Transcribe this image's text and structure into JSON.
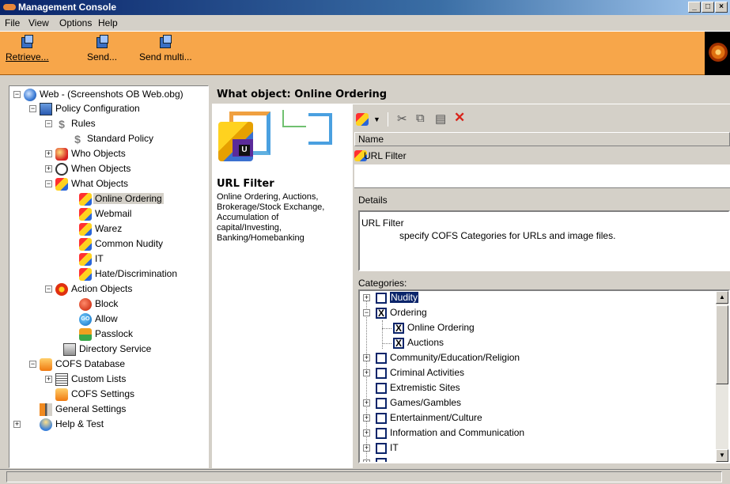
{
  "window": {
    "title": "Management Console",
    "controls": {
      "minimize": "_",
      "maximize": "□",
      "close": "×"
    }
  },
  "menu": {
    "items": [
      "File",
      "View",
      "Options",
      "Help"
    ]
  },
  "toolbar": {
    "buttons": [
      "Retrieve...",
      "Send...",
      "Send multi..."
    ]
  },
  "tree": {
    "root": "Web - (Screenshots OB Web.obg)",
    "policy_config": "Policy Configuration",
    "rules": "Rules",
    "standard_policy": "Standard Policy",
    "who_objects": "Who Objects",
    "when_objects": "When Objects",
    "what_objects": "What Objects",
    "what_children": [
      "Online Ordering",
      "Webmail",
      "Warez",
      "Common Nudity",
      "IT",
      "Hate/Discrimination"
    ],
    "action_objects": "Action Objects",
    "action_children": [
      "Block",
      "Allow",
      "Passlock"
    ],
    "directory_service": "Directory Service",
    "cofs_database": "COFS Database",
    "custom_lists": "Custom Lists",
    "cofs_settings": "COFS Settings",
    "general_settings": "General Settings",
    "help_test": "Help & Test",
    "allow_icon_text": "GO"
  },
  "header": {
    "title": "What object: Online Ordering"
  },
  "info": {
    "title": "URL Filter",
    "lines": [
      "Online Ordering, Auctions,",
      "Brokerage/Stock Exchange,",
      "Accumulation of",
      "capital/Investing,",
      "Banking/Homebanking"
    ],
    "graphic_letter": "U"
  },
  "name_column": {
    "header": "Name",
    "value": "URL Filter"
  },
  "details": {
    "label": "Details",
    "line1": "URL Filter",
    "line2": "specify COFS Categories for URLs and image files."
  },
  "categories": {
    "label": "Categories:",
    "rows": [
      {
        "label": "Nudity",
        "checked": false,
        "highlight": true
      },
      {
        "label": "Ordering",
        "checked": true
      },
      {
        "label": "Online Ordering",
        "checked": true
      },
      {
        "label": "Auctions",
        "checked": true
      },
      {
        "label": "Community/Education/Religion",
        "checked": false
      },
      {
        "label": "Criminal Activities",
        "checked": false
      },
      {
        "label": "Extremistic Sites",
        "checked": false
      },
      {
        "label": "Games/Gambles",
        "checked": false
      },
      {
        "label": "Entertainment/Culture",
        "checked": false
      },
      {
        "label": "Information and Communication",
        "checked": false
      },
      {
        "label": "IT",
        "checked": false
      }
    ],
    "check_mark": "X"
  },
  "icons": {
    "toolbar": [
      "retrieve-icon",
      "send-icon",
      "send-multi-icon"
    ],
    "rp_toolbar": [
      "new-object-icon",
      "dropdown-arrow-icon",
      "cut-icon",
      "copy-icon",
      "paste-icon",
      "delete-icon"
    ]
  },
  "colors": {
    "toolbar_bg": "#f7a64a",
    "titlebar": "#0a246a",
    "highlight": "#0a246a",
    "delete": "#d8231a"
  }
}
